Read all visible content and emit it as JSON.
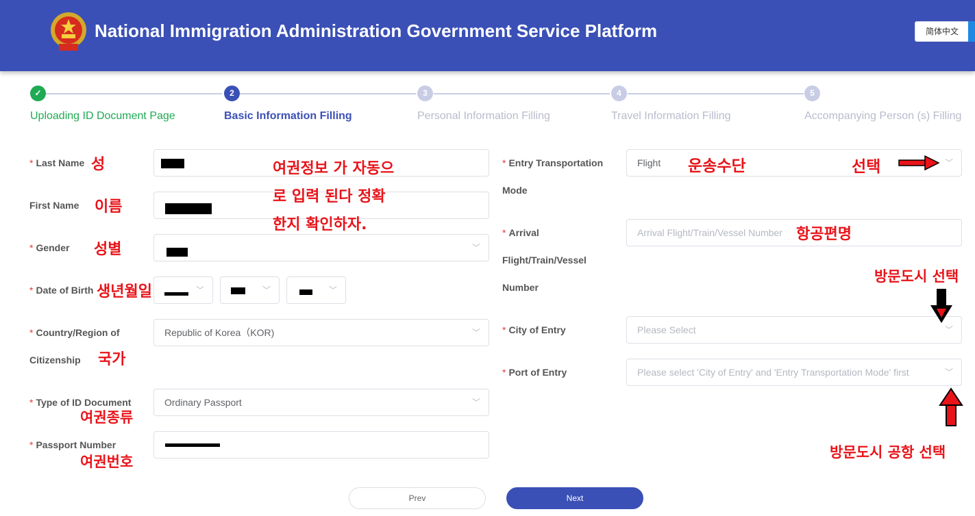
{
  "header": {
    "title": "National Immigration Administration Government Service Platform",
    "language_button": "简体中文"
  },
  "steps": [
    {
      "number": "✓",
      "label": "Uploading ID Document Page",
      "status": "done"
    },
    {
      "number": "2",
      "label": "Basic Information Filling",
      "status": "active"
    },
    {
      "number": "3",
      "label": "Personal Information Filling",
      "status": "pending"
    },
    {
      "number": "4",
      "label": "Travel Information Filling",
      "status": "pending"
    },
    {
      "number": "5",
      "label": "Accompanying Person (s) Filling",
      "status": "pending"
    }
  ],
  "colors": {
    "accent": "#3a50b6",
    "done": "#1faa53",
    "pending": "#c8cce4",
    "annotation": "#e8141a"
  },
  "form_left": {
    "last_name": {
      "label": "Last Name",
      "required": true
    },
    "first_name": {
      "label": "First Name",
      "required": false
    },
    "gender": {
      "label": "Gender",
      "required": true
    },
    "dob": {
      "label": "Date of Birth",
      "required": true
    },
    "citizenship": {
      "label_1": "Country/Region of",
      "label_2": "Citizenship",
      "required": true,
      "value": "Republic of Korea（KOR)"
    },
    "id_type": {
      "label": "Type of ID Document",
      "required": true,
      "value": "Ordinary Passport"
    },
    "passport": {
      "label": "Passport Number",
      "required": true
    }
  },
  "form_right": {
    "transport": {
      "label_1": "Entry Transportation",
      "label_2": "Mode",
      "required": true,
      "value": "Flight"
    },
    "arrival": {
      "label_1": "Arrival",
      "label_2": "Flight/Train/Vessel",
      "label_3": "Number",
      "required": true,
      "placeholder": "Arrival Flight/Train/Vessel Number"
    },
    "city": {
      "label": "City of Entry",
      "required": true,
      "placeholder": "Please Select"
    },
    "port": {
      "label": "Port of Entry",
      "required": true,
      "placeholder": "Please select 'City of Entry' and 'Entry Transportation Mode' first"
    }
  },
  "buttons": {
    "prev": "Prev",
    "next": "Next"
  },
  "annotations": {
    "last_name": "성",
    "first_name": "이름",
    "gender": "성별",
    "dob": "생년월일",
    "country": "국가",
    "id_type": "여권종류",
    "passport": "여권번호",
    "auto_1": "여권정보 가 자동으",
    "auto_2": "로 입력 된다 정확",
    "auto_3": "한지 확인하자.",
    "transport": "운송수단",
    "select": "선택",
    "flight": "항공편명",
    "city": "방문도시 선택",
    "port": "방문도시 공항 선택"
  }
}
